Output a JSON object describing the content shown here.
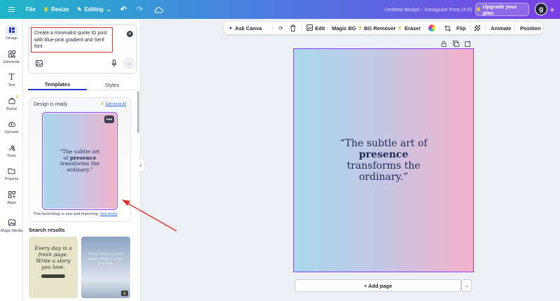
{
  "topbar": {
    "file": "File",
    "resize": "Resize",
    "editing": "Editing",
    "doc_title": "Untitled design - Instagram Post (4:5)",
    "upgrade": "Upgrade your plan",
    "avatar": "g",
    "plus": "+"
  },
  "rail": {
    "items": [
      {
        "label": "Design",
        "icon": "design-icon"
      },
      {
        "label": "Elements",
        "icon": "elements-icon"
      },
      {
        "label": "Text",
        "icon": "text-icon"
      },
      {
        "label": "Brand",
        "icon": "brand-icon"
      },
      {
        "label": "Uploads",
        "icon": "uploads-icon"
      },
      {
        "label": "Tools",
        "icon": "tools-icon"
      },
      {
        "label": "Projects",
        "icon": "projects-icon"
      },
      {
        "label": "Apps",
        "icon": "apps-icon"
      },
      {
        "label": "Magic Media",
        "icon": "magic-media-icon"
      }
    ]
  },
  "panel": {
    "prompt": "Create a minimalist quote IG post with blue-pink gradient and Serif font",
    "tabs": [
      "Templates",
      "Styles"
    ],
    "design_ready": "Design is ready",
    "get_more": "Get more AI",
    "thumb_quote_1": "“The subtle art of ",
    "thumb_quote_bold": "presence",
    "thumb_quote_2": " transforms the ordinary.”",
    "improving": "This technology is new and improving.",
    "see_terms": "See terms",
    "search_results": "Search results",
    "result1": "Every day is a fresh page. Write a story you love.",
    "result2": "Every day is a fresh page. Write a story you love."
  },
  "toolbar": {
    "ask_canva": "Ask Canva",
    "edit": "Edit",
    "magic_bg": "Magic BG",
    "bg_remover": "BG Remover",
    "eraser": "Eraser",
    "flip": "Flip",
    "animate": "Animate",
    "position": "Position"
  },
  "canvas": {
    "quote_1": "“The subtle art of ",
    "quote_bold": "presence",
    "quote_2": " transforms the ordinary.”"
  },
  "add_page": "+ Add page",
  "colors": {
    "accent": "#8b3bf0",
    "gradient_blue": "#a9d8ee",
    "gradient_pink": "#f3b2c8",
    "annotation_red": "#e0302a"
  }
}
